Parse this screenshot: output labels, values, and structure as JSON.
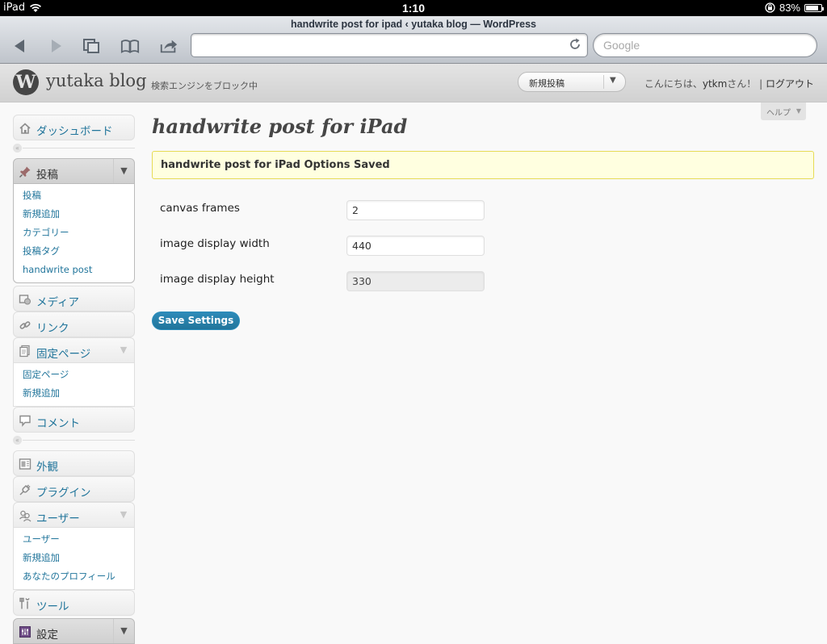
{
  "statusbar": {
    "device": "iPad",
    "time": "1:10",
    "battery": "83%",
    "battery_level": 0.83
  },
  "browser": {
    "page_title": "handwrite post for ipad ‹ yutaka blog — WordPress",
    "url": "",
    "search_placeholder": "Google",
    "toolbar_icons": [
      "back-icon",
      "forward-icon",
      "tabs-icon",
      "bookmarks-icon",
      "share-icon",
      "reload-icon"
    ]
  },
  "header": {
    "site_name": "yutaka blog",
    "search_engine_notice": "検索エンジンをブロック中",
    "new_post_select": "新規投稿",
    "greeting_prefix": "こんにちは、",
    "user": "ytkm",
    "greeting_suffix": "さん！ | ",
    "logout": "ログアウト"
  },
  "help": {
    "label": "ヘルプ"
  },
  "menu": {
    "dashboard": "ダッシュボード",
    "posts": {
      "label": "投稿",
      "items": [
        "投稿",
        "新規追加",
        "カテゴリー",
        "投稿タグ",
        "handwrite post"
      ]
    },
    "media": "メディア",
    "links": "リンク",
    "pages": {
      "label": "固定ページ",
      "items": [
        "固定ページ",
        "新規追加"
      ]
    },
    "comments": "コメント",
    "appearance": "外観",
    "plugins": "プラグイン",
    "users": {
      "label": "ユーザー",
      "items": [
        "ユーザー",
        "新規追加",
        "あなたのプロフィール"
      ]
    },
    "tools": "ツール",
    "settings": "設定"
  },
  "main": {
    "title": "handwrite post for iPad",
    "notice": "handwrite post for iPad Options Saved",
    "fields": [
      {
        "label": "canvas frames",
        "value": "2",
        "disabled": false
      },
      {
        "label": "image display width",
        "value": "440",
        "disabled": false
      },
      {
        "label": "image display height",
        "value": "330",
        "disabled": true
      }
    ],
    "save_button": "Save Settings"
  },
  "colors": {
    "link": "#21759b",
    "notice_bg": "#ffffe0",
    "notice_border": "#e6db55",
    "button": "#21759b"
  }
}
